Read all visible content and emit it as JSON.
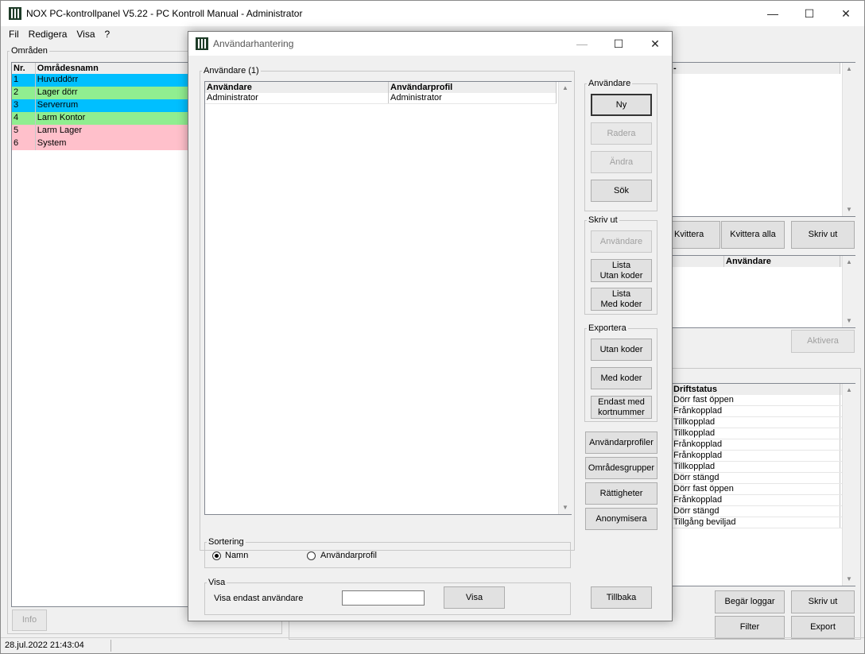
{
  "main": {
    "title": "NOX PC-kontrollpanel V5.22 - PC Kontroll Manual - Administrator",
    "menu": [
      "Fil",
      "Redigera",
      "Visa",
      "?"
    ],
    "areas": {
      "legend": "Områden",
      "col_nr": "Nr.",
      "col_name": "Områdesnamn",
      "rows": [
        {
          "nr": "1",
          "name": "Huvuddörr",
          "color": "#00bfff"
        },
        {
          "nr": "2",
          "name": "Lager dörr",
          "color": "#90ee90"
        },
        {
          "nr": "3",
          "name": "Serverrum",
          "color": "#00bfff"
        },
        {
          "nr": "4",
          "name": "Larm Kontor",
          "color": "#90ee90"
        },
        {
          "nr": "5",
          "name": "Larm Lager",
          "color": "#ffc0cb"
        },
        {
          "nr": "6",
          "name": "System",
          "color": "#ffc0cb"
        }
      ]
    },
    "info_button": "Info",
    "alarm_buttons": {
      "ack": "Kvittera",
      "ack_all": "Kvittera alla",
      "print": "Skriv ut"
    },
    "user_col": "Användare",
    "activate_button": "Aktivera",
    "status_col": "Driftstatus",
    "status_rows": [
      "Dörr fast öppen",
      "Frånkopplad",
      "Tillkopplad",
      "Tillkopplad",
      "Frånkopplad",
      "Frånkopplad",
      "Tillkopplad",
      "Dörr stängd",
      "Dörr fast öppen",
      "Frånkopplad",
      "Dörr stängd",
      "Tillgång beviljad"
    ],
    "log_buttons": {
      "request_logs": "Begär loggar",
      "print": "Skriv ut",
      "filter": "Filter",
      "export": "Export"
    },
    "statusbar_datetime": "28.jul.2022  21:43:04"
  },
  "dialog": {
    "title": "Användarhantering",
    "users_legend": "Användare (1)",
    "col_user": "Användare",
    "col_profile": "Användarprofil",
    "users": [
      {
        "user": "Administrator",
        "profile": "Administrator"
      }
    ],
    "group_users": "Användare",
    "btn_new": "Ny",
    "btn_delete": "Radera",
    "btn_edit": "Ändra",
    "btn_search": "Sök",
    "group_print": "Skriv ut",
    "btn_print_users": "Användare",
    "btn_list_no_codes_1": "Lista",
    "btn_list_no_codes_2": "Utan koder",
    "btn_list_codes_1": "Lista",
    "btn_list_codes_2": "Med koder",
    "group_export": "Exportera",
    "btn_exp_no_codes": "Utan koder",
    "btn_exp_codes": "Med koder",
    "btn_exp_card_1": "Endast med",
    "btn_exp_card_2": "kortnummer",
    "btn_profiles": "Användarprofiler",
    "btn_area_groups": "Områdesgrupper",
    "btn_rights": "Rättigheter",
    "btn_anonymize": "Anonymisera",
    "sort_legend": "Sortering",
    "sort_name": "Namn",
    "sort_profile": "Användarprofil",
    "show_legend": "Visa",
    "show_label": "Visa endast användare",
    "show_input": "",
    "btn_show": "Visa",
    "btn_back": "Tillbaka"
  }
}
